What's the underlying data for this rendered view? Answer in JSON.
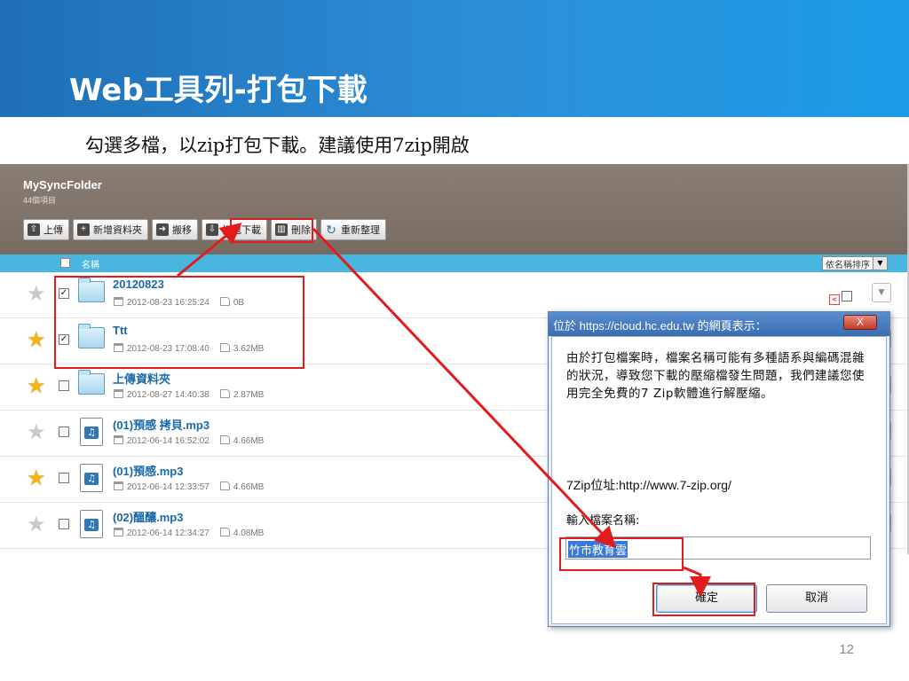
{
  "slide": {
    "title": "Web工具列-打包下載",
    "subtitle": "勾選多檔，以zip打包下載。建議使用7zip開啟",
    "page_number": "12"
  },
  "app": {
    "name": "MySyncFolder",
    "item_count": "44個項目",
    "toolbar": [
      {
        "label": "上傳",
        "icon": "upload-icon"
      },
      {
        "label": "新增資料夾",
        "icon": "new-folder-icon"
      },
      {
        "label": "搬移",
        "icon": "move-icon"
      },
      {
        "label": "打包下載",
        "icon": "zip-download-icon"
      },
      {
        "label": "刪除",
        "icon": "trash-icon"
      },
      {
        "label": "重新整理",
        "icon": "refresh-icon"
      }
    ],
    "list_header": {
      "name_col": "名稱",
      "sort_label": "依名稱排序"
    },
    "files": [
      {
        "name": "20120823",
        "date": "2012-08-23 16:25:24",
        "size": "0B",
        "type": "folder",
        "starred": false,
        "checked": true
      },
      {
        "name": "Ttt",
        "date": "2012-08-23 17:08:40",
        "size": "3.62MB",
        "type": "folder",
        "starred": true,
        "checked": true
      },
      {
        "name": "上傳資料夾",
        "date": "2012-08-27 14:40:38",
        "size": "2.87MB",
        "type": "folder",
        "starred": true,
        "checked": false
      },
      {
        "name": "(01)預感 拷貝.mp3",
        "date": "2012-06-14 16:52:02",
        "size": "4.66MB",
        "type": "audio",
        "starred": false,
        "checked": false
      },
      {
        "name": "(01)預感.mp3",
        "date": "2012-06-14 12:33:57",
        "size": "4.66MB",
        "type": "audio",
        "starred": true,
        "checked": false
      },
      {
        "name": "(02)醞釀.mp3",
        "date": "2012-06-14 12:34:27",
        "size": "4.08MB",
        "type": "audio",
        "starred": false,
        "checked": false
      }
    ]
  },
  "dialog": {
    "title": "位於 https://cloud.hc.edu.tw 的網頁表示：",
    "close_label": "X",
    "message": "由於打包檔案時，檔案名稱可能有多種語系與編碼混雜的狀況，導致您下載的壓縮檔發生問題，我們建議您使用完全免費的7 Zip軟體進行解壓縮。",
    "url_line": "7Zip位址:http://www.7-zip.org/",
    "prompt": "輸入檔案名稱:",
    "input_value": "竹市教育雲",
    "ok_label": "確定",
    "cancel_label": "取消"
  },
  "colors": {
    "header_blue": "#2c8fd8",
    "app_topbar": "#7f7369",
    "list_header": "#49b6e0",
    "highlight_red": "#e21b1b",
    "link_blue": "#1a6aa8"
  }
}
